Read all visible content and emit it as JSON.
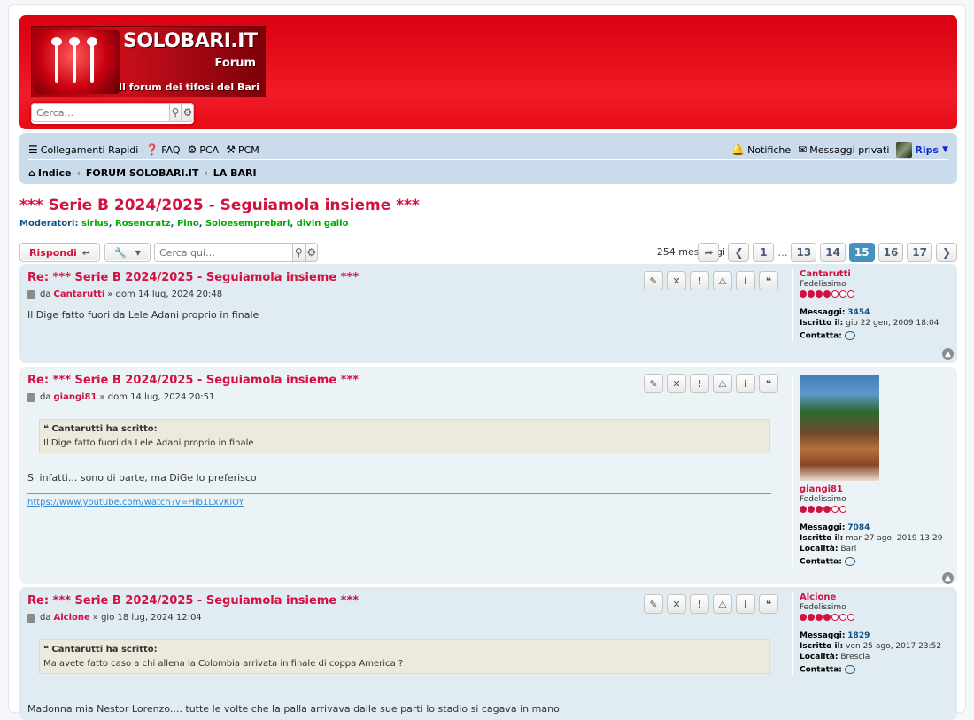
{
  "site": {
    "logo_title": "SOLOBARI.IT",
    "logo_sub": "Forum",
    "logo_tag": "Il forum dei tifosi del Bari",
    "search_placeholder": "Cerca..."
  },
  "nav": {
    "quick_links": "Collegamenti Rapidi",
    "faq": "FAQ",
    "pca": "PCA",
    "pcm": "PCM",
    "notifications": "Notifiche",
    "private_messages": "Messaggi privati",
    "user": "Rips",
    "breadcrumbs": [
      "Indice",
      "FORUM SOLOBARI.IT",
      "LA BARI"
    ]
  },
  "topic": {
    "title": "*** Serie B 2024/2025 - Seguiamola insieme ***",
    "moderators_label": "Moderatori:",
    "moderators": [
      "sirius",
      "Rosencratz",
      "Pino",
      "Soloesemprebari",
      "divin gallo"
    ],
    "reply_label": "Rispondi",
    "search_placeholder": "Cerca qui…",
    "post_count": "254 messaggi",
    "pages": [
      "1",
      "13",
      "14",
      "15",
      "16",
      "17"
    ],
    "current_page": "15",
    "ellipsis": "…"
  },
  "posts": [
    {
      "title": "Re: *** Serie B 2024/2025 - Seguiamola insieme ***",
      "by": "da",
      "author": "Cantarutti",
      "date": "» dom 14 lug, 2024 20:48",
      "body": "Il Dige fatto fuori da Lele Adani proprio in finale",
      "rank": "Fedelissimo",
      "messages_label": "Messaggi:",
      "messages": "3454",
      "joined_label": "Iscritto il:",
      "joined": "gio 22 gen, 2009 18:04",
      "contact_label": "Contatta:"
    },
    {
      "title": "Re: *** Serie B 2024/2025 - Seguiamola insieme ***",
      "by": "da",
      "author": "giangi81",
      "date": "» dom 14 lug, 2024 20:51",
      "quote_author": "Cantarutti ha scritto:",
      "quote_text": "Il Dige fatto fuori da Lele Adani proprio in finale",
      "body": "Si infatti... sono di parte, ma DiGe lo preferisco",
      "signature_link": "https://www.youtube.com/watch?v=Hib1LxvKiOY",
      "rank": "Fedelissimo",
      "messages_label": "Messaggi:",
      "messages": "7084",
      "joined_label": "Iscritto il:",
      "joined": "mar 27 ago, 2019 13:29",
      "location_label": "Località:",
      "location": "Bari",
      "contact_label": "Contatta:"
    },
    {
      "title": "Re: *** Serie B 2024/2025 - Seguiamola insieme ***",
      "by": "da",
      "author": "Alcione",
      "date": "» gio 18 lug, 2024 12:04",
      "quote_author": "Cantarutti ha scritto:",
      "quote_text": "Ma avete fatto caso a chi allena la Colombia arrivata in finale di coppa America ?",
      "body": "Madonna mia Nestor Lorenzo.... tutte le volte che la palla arrivava dalle sue parti lo stadio si cagava in mano",
      "rank": "Fedelissimo",
      "messages_label": "Messaggi:",
      "messages": "1829",
      "joined_label": "Iscritto il:",
      "joined": "ven 25 ago, 2017 23:52",
      "location_label": "Località:",
      "location": "Brescia",
      "contact_label": "Contatta:"
    }
  ],
  "colors": {
    "header_red": "#e80a17",
    "link_red": "#d31141",
    "nav_bg": "#cadceb",
    "moderator_green": "#00aa00",
    "active_page": "#4692bf"
  }
}
